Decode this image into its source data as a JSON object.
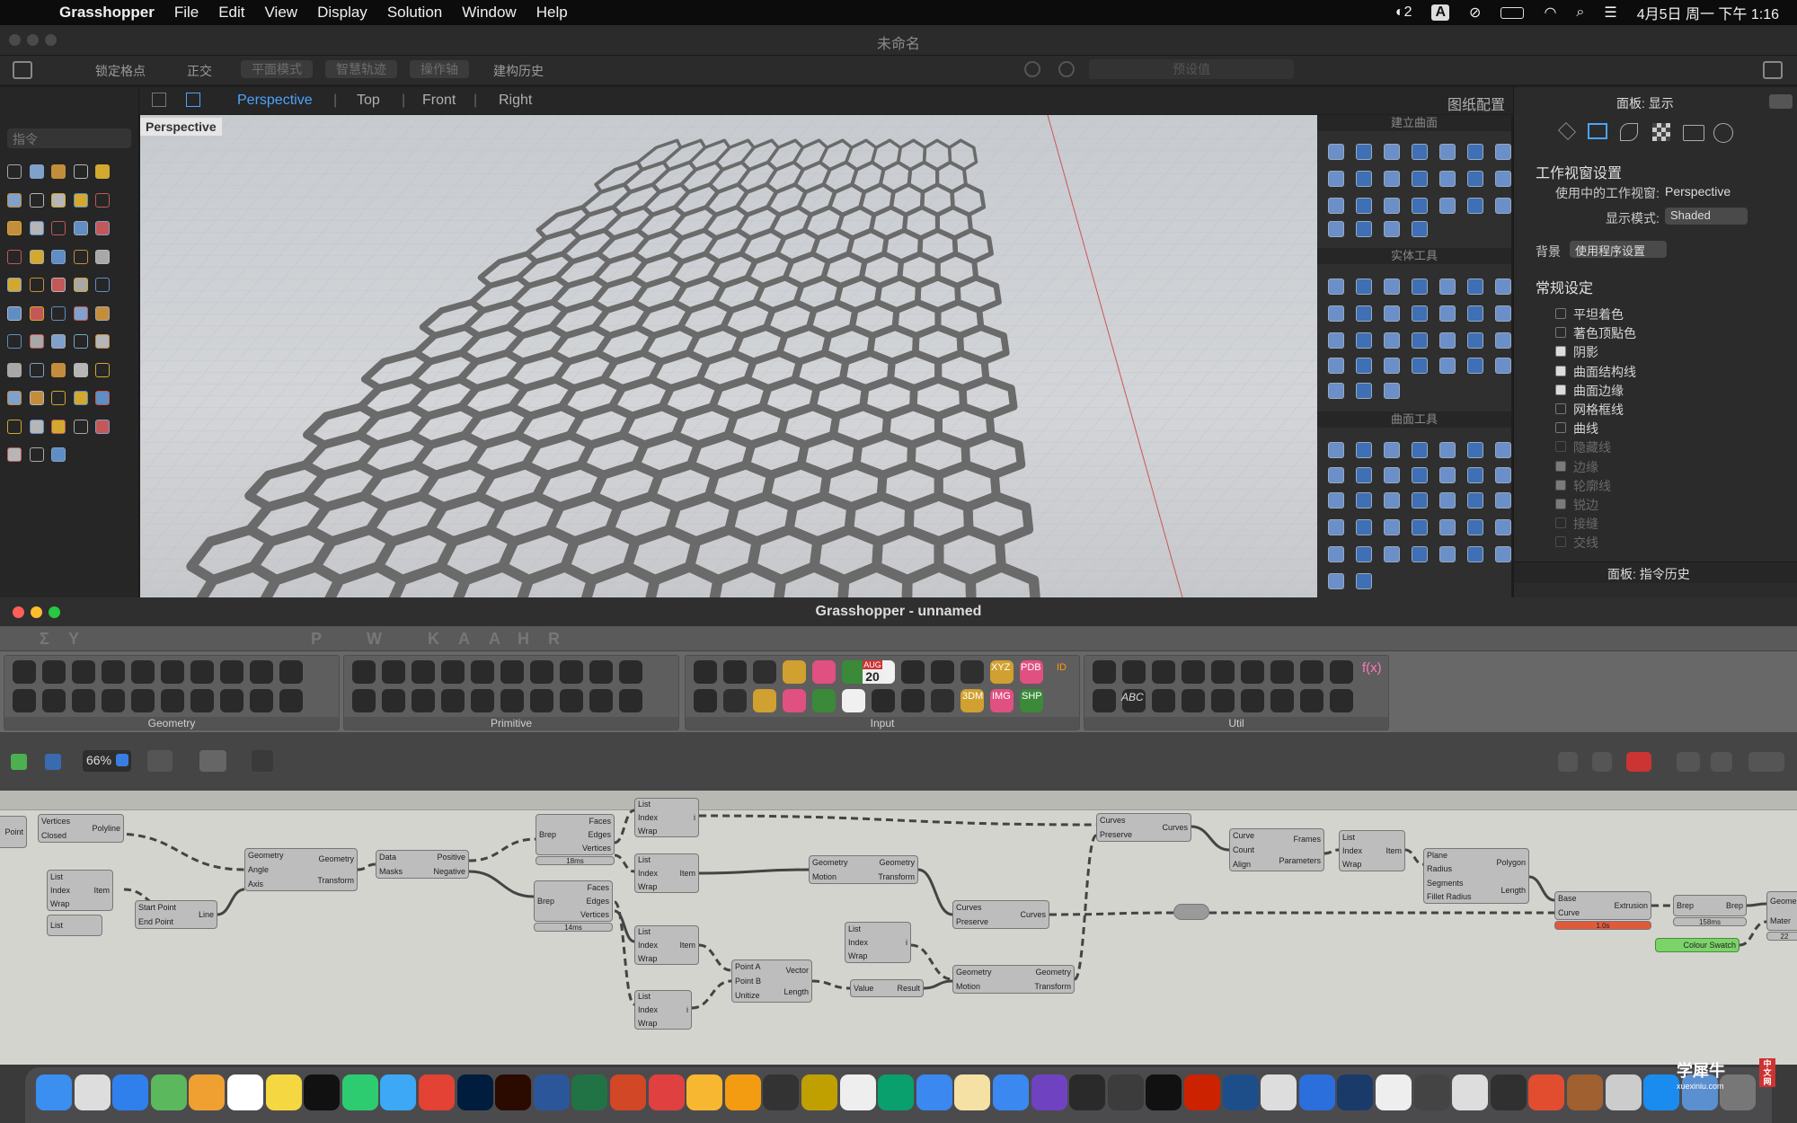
{
  "menubar": {
    "app": "Grasshopper",
    "items": [
      "File",
      "Edit",
      "View",
      "Display",
      "Solution",
      "Window",
      "Help"
    ],
    "status": {
      "notif_count": "2",
      "input_method": "A",
      "datetime": "4月5日 周一 下午 1:16"
    }
  },
  "window": {
    "title": "未命名"
  },
  "toolbar": {
    "lock_grid": "锁定格点",
    "ortho": "正交",
    "plane_mode": "平面模式",
    "smart_track": "智慧轨迹",
    "gumball": "操作轴",
    "history": "建构历史",
    "default_value": "预设值"
  },
  "viewport_tabs": {
    "tabs": [
      "Perspective",
      "Top",
      "Front",
      "Right"
    ],
    "active": "Perspective",
    "layout": "图纸配置",
    "label": "Perspective"
  },
  "command": {
    "placeholder": "指令"
  },
  "float_panels": {
    "surface": "建立曲面",
    "solid": "实体工具",
    "surface_tools": "曲面工具"
  },
  "right_panel": {
    "title": "面板: 显示",
    "section": "工作视窗设置",
    "current_view_label": "使用中的工作视窗:",
    "current_view": "Perspective",
    "display_mode_label": "显示模式:",
    "display_mode": "Shaded",
    "bg_label": "背景",
    "bg_value": "使用程序设置",
    "general": "常规设定",
    "checks": [
      {
        "label": "平坦着色",
        "on": false,
        "dim": false
      },
      {
        "label": "著色顶點色",
        "on": false,
        "dim": false
      },
      {
        "label": "阴影",
        "on": true,
        "dim": false
      },
      {
        "label": "曲面结构线",
        "on": true,
        "dim": false
      },
      {
        "label": "曲面边缘",
        "on": true,
        "dim": false
      },
      {
        "label": "网格框线",
        "on": false,
        "dim": false
      },
      {
        "label": "曲线",
        "on": false,
        "dim": false
      },
      {
        "label": "隐藏线",
        "on": false,
        "dim": true
      },
      {
        "label": "边缘",
        "on": true,
        "dim": true
      },
      {
        "label": "轮廓线",
        "on": true,
        "dim": true
      },
      {
        "label": "锐边",
        "on": true,
        "dim": true
      },
      {
        "label": "接缝",
        "on": false,
        "dim": true
      },
      {
        "label": "交线",
        "on": false,
        "dim": true
      }
    ],
    "history_title": "面板: 指令历史"
  },
  "grasshopper": {
    "title": "Grasshopper - unnamed",
    "tabs": [
      "Σ",
      "Y",
      "K",
      "A",
      "A",
      "H",
      "R",
      "P",
      "W"
    ],
    "groups": [
      "Geometry",
      "Primitive",
      "Input",
      "Util"
    ],
    "zoom": "66%",
    "ribbon_text": {
      "aug": "AUG",
      "day": "20",
      "xyz": "XYZ",
      "pdb": "PDB",
      "id": "ID",
      "t3dm": "3DM",
      "img": "IMG",
      "shp": "SHP",
      "fx": "f(x)",
      "abc": "ABC"
    },
    "nodes": [
      {
        "id": "point",
        "title": "",
        "inputs": [],
        "outputs": [
          "Point"
        ]
      },
      {
        "id": "polyline",
        "inputs": [
          "Vertices",
          "Closed"
        ],
        "outputs": [
          "Polyline"
        ]
      },
      {
        "id": "list1",
        "inputs": [
          "List",
          "Index",
          "Wrap"
        ],
        "outputs": [
          "Item"
        ]
      },
      {
        "id": "list2",
        "inputs": [
          "List"
        ],
        "outputs": []
      },
      {
        "id": "line",
        "inputs": [
          "Start Point",
          "End Point"
        ],
        "outputs": [
          "Line"
        ]
      },
      {
        "id": "rotate",
        "inputs": [
          "Geometry",
          "Angle",
          "Axis"
        ],
        "outputs": [
          "Geometry",
          "Transform"
        ]
      },
      {
        "id": "dispatch",
        "inputs": [
          "Data",
          "Masks"
        ],
        "outputs": [
          "Positive",
          "Negative"
        ]
      },
      {
        "id": "dbrep1",
        "inputs": [
          "Brep"
        ],
        "outputs": [
          "Faces",
          "Edges",
          "Vertices"
        ],
        "time": "18ms"
      },
      {
        "id": "dbrep2",
        "inputs": [
          "Brep"
        ],
        "outputs": [
          "Faces",
          "Edges",
          "Vertices"
        ],
        "time": "14ms"
      },
      {
        "id": "list3",
        "inputs": [
          "List",
          "Index",
          "Wrap"
        ],
        "outputs": [
          "i"
        ]
      },
      {
        "id": "list4",
        "inputs": [
          "List",
          "Index",
          "Wrap"
        ],
        "outputs": [
          "Item"
        ]
      },
      {
        "id": "list5",
        "inputs": [
          "List",
          "Index",
          "Wrap"
        ],
        "outputs": [
          "Item"
        ]
      },
      {
        "id": "list6",
        "inputs": [
          "List",
          "Index",
          "Wrap"
        ],
        "outputs": [
          "i"
        ]
      },
      {
        "id": "move1",
        "inputs": [
          "Geometry",
          "Motion"
        ],
        "outputs": [
          "Geometry",
          "Transform"
        ]
      },
      {
        "id": "list7",
        "inputs": [
          "List",
          "Index",
          "Wrap"
        ],
        "outputs": [
          "i"
        ]
      },
      {
        "id": "vector",
        "inputs": [
          "Point A",
          "Point B",
          "Unitize"
        ],
        "outputs": [
          "Vector",
          "Length"
        ]
      },
      {
        "id": "negative",
        "inputs": [
          "Value"
        ],
        "outputs": [
          "Result"
        ]
      },
      {
        "id": "join1",
        "inputs": [
          "Curves",
          "Preserve"
        ],
        "outputs": [
          "Curves"
        ]
      },
      {
        "id": "move2",
        "inputs": [
          "Geometry",
          "Motion"
        ],
        "outputs": [
          "Geometry",
          "Transform"
        ]
      },
      {
        "id": "join2",
        "inputs": [
          "Curves",
          "Preserve"
        ],
        "outputs": [
          "Curves"
        ]
      },
      {
        "id": "divide",
        "inputs": [
          "Curve",
          "Count",
          "Align"
        ],
        "outputs": [
          "Frames",
          "Parameters"
        ]
      },
      {
        "id": "list8",
        "inputs": [
          "List",
          "Index",
          "Wrap"
        ],
        "outputs": [
          "Item"
        ]
      },
      {
        "id": "polygon",
        "inputs": [
          "Plane",
          "Radius",
          "Segments",
          "Fillet Radius"
        ],
        "outputs": [
          "Polygon",
          "Length"
        ]
      },
      {
        "id": "extrude",
        "inputs": [
          "Base",
          "Curve"
        ],
        "outputs": [
          "Extrusion"
        ],
        "time": "1.0s"
      },
      {
        "id": "cap",
        "inputs": [
          "Brep"
        ],
        "outputs": [
          "Brep"
        ],
        "time": "158ms"
      },
      {
        "id": "swatch",
        "inputs": [],
        "outputs": [
          "Colour Swatch"
        ]
      },
      {
        "id": "preview",
        "inputs": [
          "Geome",
          "Mater"
        ],
        "outputs": [],
        "time": "22"
      }
    ]
  },
  "watermark": {
    "line1": "学犀牛",
    "line2": "xuexiniu.com",
    "badge": "中文网"
  }
}
